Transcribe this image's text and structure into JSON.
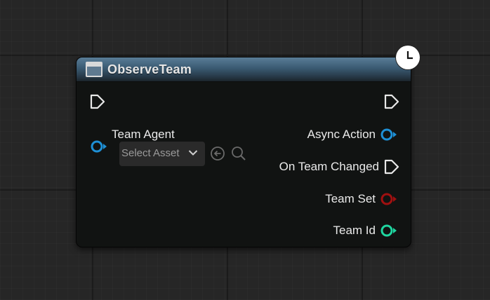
{
  "node": {
    "title": "ObserveTeam",
    "header_color": "#3a5a72",
    "latent_icon": "clock-icon",
    "node_icon": "function-node-icon"
  },
  "inputs": {
    "exec_icon": "exec-pin-icon",
    "team_agent": {
      "label": "Team Agent",
      "pin_color": "#1e90d6",
      "placeholder": "Select Asset",
      "dropdown_icon": "chevron-down-icon",
      "use_icon": "use-selected-asset-icon",
      "browse_icon": "search-icon"
    }
  },
  "outputs": {
    "exec_icon": "exec-pin-icon",
    "async_action": {
      "label": "Async Action",
      "pin_color": "#1e90d6"
    },
    "on_team_changed": {
      "label": "On Team Changed",
      "pin_color": "#ffffff"
    },
    "team_set": {
      "label": "Team Set",
      "pin_color": "#a01010"
    },
    "team_id": {
      "label": "Team Id",
      "pin_color": "#1fd6a0"
    }
  }
}
